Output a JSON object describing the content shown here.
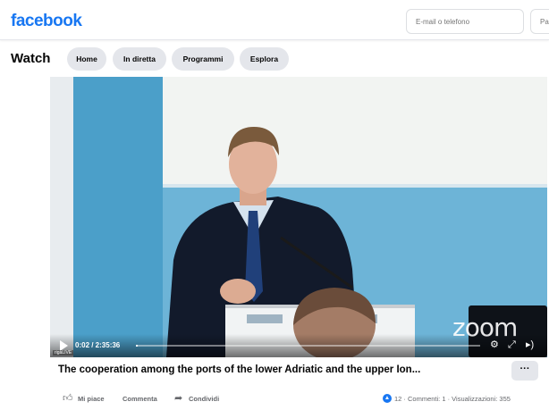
{
  "header": {
    "logo": "facebook",
    "email_placeholder": "E-mail o telefono",
    "password_placeholder": "Pa"
  },
  "watch": {
    "title": "Watch",
    "tabs": [
      {
        "label": "Home"
      },
      {
        "label": "In diretta"
      },
      {
        "label": "Programmi"
      },
      {
        "label": "Esplora"
      }
    ]
  },
  "video": {
    "time": "0:02 / 2:35:36",
    "progress": 0.0002,
    "watermark": "zoom",
    "corner_tag": "rigaLIVE"
  },
  "post": {
    "title": "The cooperation among the ports of the lower Adriatic and the upper Ion...",
    "more_label": "···",
    "actions": {
      "like": "Mi piace",
      "comment": "Commenta",
      "share": "Condividi"
    },
    "stats": "12 · Commenti: 1 · Visualizzazioni: 355"
  },
  "colors": {
    "brand": "#1877f2",
    "pill_bg": "#e4e6eb",
    "secondary_text": "#65676b"
  },
  "icons": {
    "play": "play-icon",
    "settings": "gear-icon",
    "fullscreen": "fullscreen-icon",
    "volume": "volume-icon",
    "like": "thumbs-up-icon",
    "share": "share-icon"
  }
}
